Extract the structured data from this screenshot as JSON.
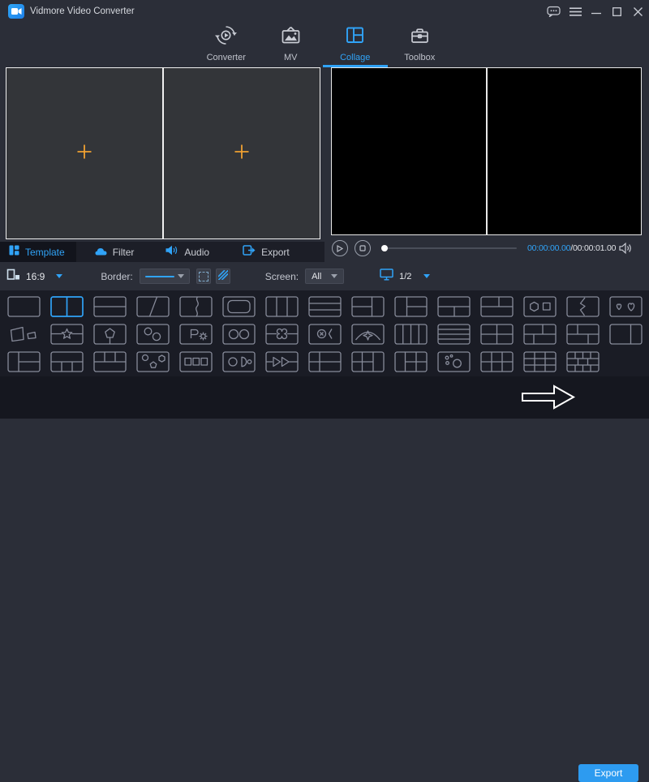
{
  "window": {
    "title": "Vidmore Video Converter"
  },
  "titlebar": {
    "controls": [
      "feedback-bubble",
      "menu",
      "minimize",
      "maximize",
      "close"
    ]
  },
  "nav": {
    "tabs": [
      {
        "label": "Converter",
        "icon": "converter-icon",
        "active": false
      },
      {
        "label": "MV",
        "icon": "mv-icon",
        "active": false
      },
      {
        "label": "Collage",
        "icon": "collage-icon",
        "active": true
      },
      {
        "label": "Toolbox",
        "icon": "toolbox-icon",
        "active": false
      }
    ]
  },
  "stage": {
    "placeholders": [
      "add-video-plus",
      "add-video-plus"
    ]
  },
  "subtabs": {
    "items": [
      {
        "label": "Template",
        "icon": "template-icon",
        "active": true
      },
      {
        "label": "Filter",
        "icon": "filter-cloud-icon",
        "active": false
      },
      {
        "label": "Audio",
        "icon": "speaker-icon",
        "active": false
      },
      {
        "label": "Export",
        "icon": "export-box-icon",
        "active": false
      }
    ]
  },
  "player": {
    "time_current": "00:00:00.00",
    "time_separator": "/",
    "time_total": "00:00:01.00",
    "progress_percent": 0
  },
  "toolbar": {
    "aspect_ratio": "16:9",
    "border_label": "Border:",
    "screen_label": "Screen:",
    "screen_value": "All",
    "page_indicator": "1/2"
  },
  "templates": {
    "selected_row": 0,
    "selected_col": 1,
    "rows": [
      [
        "single",
        "two-columns",
        "two-rows",
        "diagonal-split",
        "curve-split",
        "rounded-inset",
        "three-columns",
        "three-rows",
        "left-two-rows-right-column",
        "left-column-right-two-rows",
        "top-full-bottom-two",
        "top-two-bottom-full",
        "hexagon-square",
        "lightning-split",
        "two-hearts"
      ],
      [
        "skewed-frames",
        "star-center",
        "pentagon-center",
        "two-circles-diagonal",
        "flag-and-gear",
        "two-circles",
        "clover-center",
        "cross-circle-bracket",
        "arch-clover",
        "four-columns",
        "four-rows",
        "grid-2x2",
        "staggered-top-right",
        "staggered-columns",
        "wide-left-narrow-right"
      ],
      [
        "narrow-left-right-two-rows",
        "top-full-bottom-three",
        "top-three-bottom-full",
        "circle-pentagon-hexagon",
        "three-squares",
        "circle-half-dot",
        "two-triangles",
        "grid-2x2-narrow-left",
        "left-grid-right-column",
        "left-column-right-grid",
        "bubbles",
        "grid-2x3",
        "grid-3x3",
        "brick-grid"
      ]
    ]
  },
  "export": {
    "label": "Export"
  },
  "colors": {
    "accent": "#30a3f7",
    "orange": "#f0a132",
    "export_button": "#2d9bf0"
  }
}
